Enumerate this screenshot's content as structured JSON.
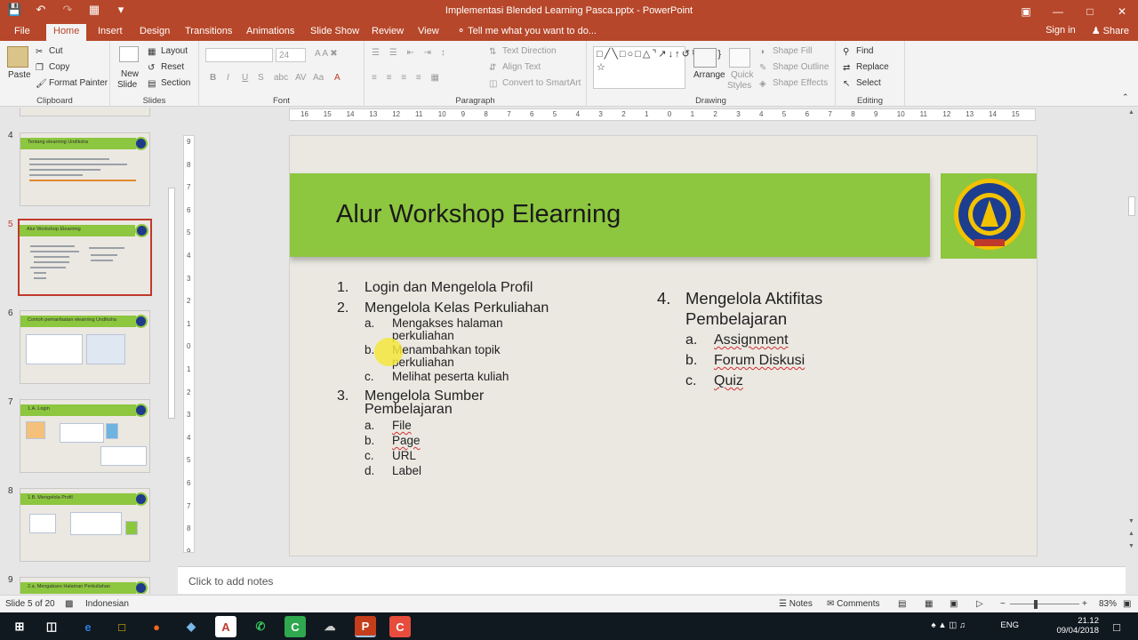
{
  "window": {
    "title": "Implementasi Blended Learning Pasca.pptx - PowerPoint"
  },
  "tabs": [
    "File",
    "Home",
    "Insert",
    "Design",
    "Transitions",
    "Animations",
    "Slide Show",
    "Review",
    "View"
  ],
  "tellme": "Tell me what you want to do...",
  "signin": "Sign in",
  "share": "Share",
  "ribbon": {
    "clipboard": {
      "paste": "Paste",
      "cut": "Cut",
      "copy": "Copy",
      "format_painter": "Format Painter",
      "label": "Clipboard"
    },
    "slides": {
      "new_slide_1": "New",
      "new_slide_2": "Slide",
      "layout": "Layout",
      "reset": "Reset",
      "section": "Section",
      "label": "Slides"
    },
    "font": {
      "size": "24",
      "label": "Font"
    },
    "paragraph": {
      "text_direction": "Text Direction",
      "align_text": "Align Text",
      "smartart": "Convert to SmartArt",
      "label": "Paragraph"
    },
    "drawing": {
      "arrange": "Arrange",
      "quick_1": "Quick",
      "quick_2": "Styles",
      "fill": "Shape Fill",
      "outline": "Shape Outline",
      "effects": "Shape Effects",
      "label": "Drawing"
    },
    "editing": {
      "find": "Find",
      "replace": "Replace",
      "select": "Select",
      "label": "Editing"
    }
  },
  "thumbnails": [
    {
      "num": "4",
      "title": "Tentang elearning Undiksha"
    },
    {
      "num": "5",
      "title": "Alur Workshop Elearning"
    },
    {
      "num": "6",
      "title": "Contoh pemanfaatan elearning Undiksha"
    },
    {
      "num": "7",
      "title": "1.A. Login"
    },
    {
      "num": "8",
      "title": "1.B. Mengelola Profil"
    },
    {
      "num": "9",
      "title": "2.a. Mengakses Halaman Perkuliahan"
    }
  ],
  "hruler_marks": [
    "16",
    "15",
    "14",
    "13",
    "12",
    "11",
    "10",
    "9",
    "8",
    "7",
    "6",
    "5",
    "4",
    "3",
    "2",
    "1",
    "0",
    "1",
    "2",
    "3",
    "4",
    "5",
    "6",
    "7",
    "8",
    "9",
    "10",
    "11",
    "12",
    "13",
    "14",
    "15",
    "16"
  ],
  "vruler_marks": [
    "9",
    "8",
    "7",
    "6",
    "5",
    "4",
    "3",
    "2",
    "1",
    "0",
    "1",
    "2",
    "3",
    "4",
    "5",
    "6",
    "7",
    "8",
    "9"
  ],
  "slide": {
    "title": "Alur Workshop Elearning",
    "left_list": [
      {
        "num": "1.",
        "text": "Login dan Mengelola Profil"
      },
      {
        "num": "2.",
        "text": "Mengelola Kelas Perkuliahan"
      },
      {
        "num": "a.",
        "text": "Mengakses halaman"
      },
      {
        "num": "",
        "text": "perkuliahan"
      },
      {
        "num": "b.",
        "text": "Menambahkan topik"
      },
      {
        "num": "",
        "text": "perkuliahan"
      },
      {
        "num": "c.",
        "text": "Melihat peserta kuliah"
      },
      {
        "num": "3.",
        "text": "Mengelola Sumber"
      },
      {
        "num": "",
        "text": "Pembelajaran"
      },
      {
        "num": "a.",
        "text": "File"
      },
      {
        "num": "b.",
        "text": "Page"
      },
      {
        "num": "c.",
        "text": "URL"
      },
      {
        "num": "d.",
        "text": "Label"
      }
    ],
    "right_list": [
      {
        "num": "4.",
        "text": "Mengelola Aktifitas"
      },
      {
        "num": "",
        "text": "Pembelajaran"
      },
      {
        "num": "a.",
        "text": "Assignment"
      },
      {
        "num": "b.",
        "text": "Forum Diskusi"
      },
      {
        "num": "c.",
        "text": "Quiz"
      }
    ]
  },
  "notes_placeholder": "Click to add notes",
  "status": {
    "slide": "Slide 5 of 20",
    "language": "Indonesian",
    "notes": "Notes",
    "comments": "Comments",
    "zoom": "83%"
  },
  "taskbar": {
    "lang": "ENG",
    "time": "21.12",
    "date": "09/04/2018"
  },
  "colors": {
    "accent": "#b7472a",
    "slide_green": "#8dc63f",
    "slide_bg": "#ebe8e2"
  }
}
